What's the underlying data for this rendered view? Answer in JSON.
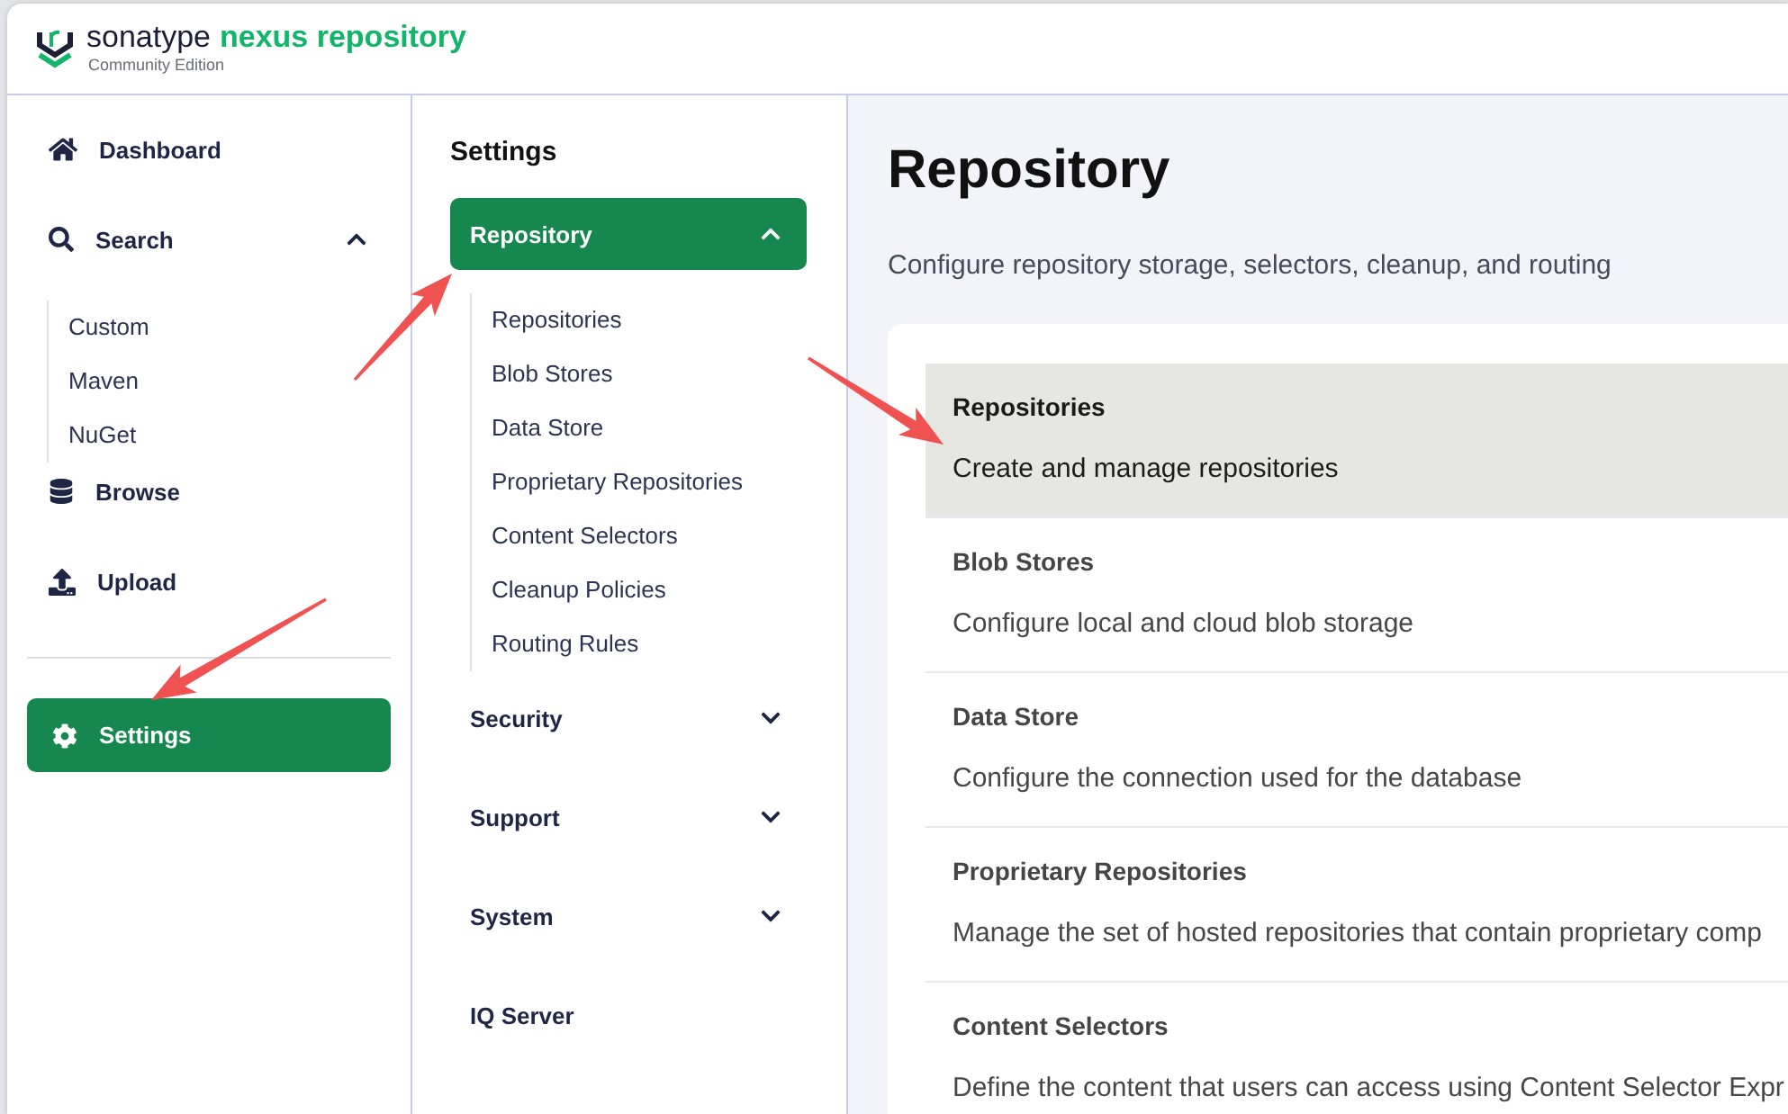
{
  "header": {
    "brand": "sonatype",
    "product": "nexus repository",
    "edition": "Community Edition"
  },
  "sidebar": {
    "items": [
      {
        "label": "Dashboard",
        "kind": "link",
        "selected": false
      },
      {
        "label": "Search",
        "kind": "group",
        "selected": false,
        "expanded": true,
        "children": [
          {
            "label": "Custom",
            "selected": false
          },
          {
            "label": "Maven",
            "selected": false
          },
          {
            "label": "NuGet",
            "selected": false
          }
        ]
      },
      {
        "label": "Browse",
        "kind": "link",
        "selected": false
      },
      {
        "label": "Upload",
        "kind": "link",
        "selected": false
      }
    ],
    "settings": {
      "label": "Settings",
      "selected": true
    }
  },
  "settings_nav": {
    "title": "Settings",
    "groups": [
      {
        "label": "Repository",
        "kind": "group",
        "selected": true,
        "expanded": true,
        "children": [
          {
            "label": "Repositories",
            "selected": false
          },
          {
            "label": "Blob Stores",
            "selected": false
          },
          {
            "label": "Data Store",
            "selected": false
          },
          {
            "label": "Proprietary Repositories",
            "selected": false
          },
          {
            "label": "Content Selectors",
            "selected": false
          },
          {
            "label": "Cleanup Policies",
            "selected": false
          },
          {
            "label": "Routing Rules",
            "selected": false
          }
        ]
      },
      {
        "label": "Security",
        "kind": "group",
        "selected": false,
        "expanded": false
      },
      {
        "label": "Support",
        "kind": "group",
        "selected": false,
        "expanded": false
      },
      {
        "label": "System",
        "kind": "group",
        "selected": false,
        "expanded": false
      },
      {
        "label": "IQ Server",
        "kind": "link",
        "selected": false
      }
    ]
  },
  "main": {
    "title": "Repository",
    "subtitle": "Configure repository storage, selectors, cleanup, and routing",
    "rows": [
      {
        "title": "Repositories",
        "description": "Create and manage repositories",
        "selected": true
      },
      {
        "title": "Blob Stores",
        "description": "Configure local and cloud blob storage",
        "selected": false
      },
      {
        "title": "Data Store",
        "description": "Configure the connection used for the database",
        "selected": false
      },
      {
        "title": "Proprietary Repositories",
        "description": "Manage the set of hosted repositories that contain proprietary comp",
        "selected": false
      },
      {
        "title": "Content Selectors",
        "description": "Define the content that users can access using Content Selector Expr",
        "selected": false
      }
    ]
  },
  "annotations": [
    {
      "kind": "arrow"
    },
    {
      "kind": "arrow"
    },
    {
      "kind": "arrow"
    }
  ]
}
